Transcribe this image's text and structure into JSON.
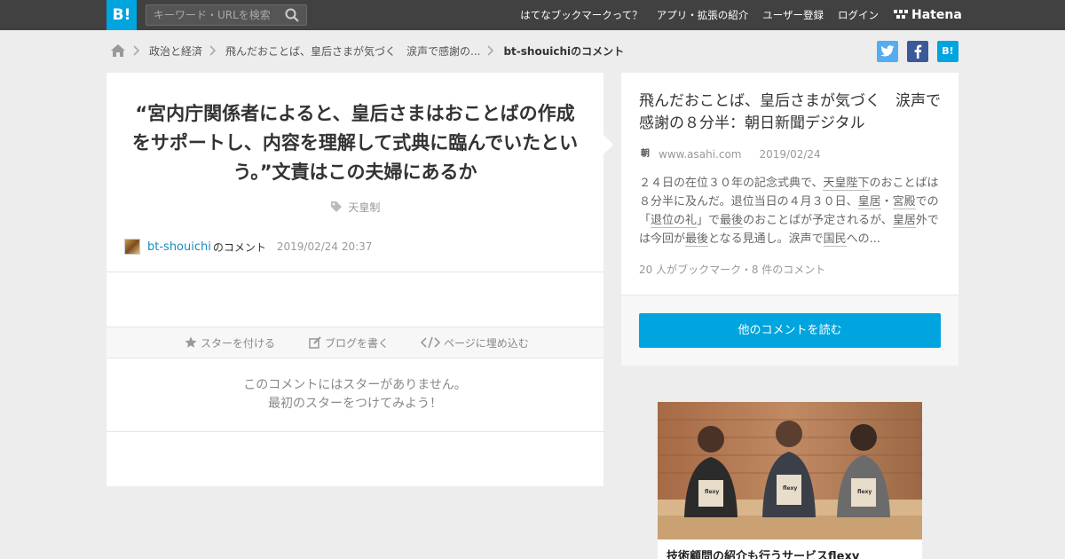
{
  "header": {
    "logo_text": "B!",
    "search_placeholder": "キーワード・URLを検索",
    "nav": [
      "はてなブックマークって？",
      "アプリ・拡張の紹介",
      "ユーザー登録",
      "ログイン"
    ],
    "brand": "Hatena"
  },
  "breadcrumb": {
    "items": [
      "政治と経済",
      "飛んだおことば、皇后さまが気づく　涙声で感謝の...",
      "bt-shouichiのコメント"
    ]
  },
  "social": {
    "twitter": "t",
    "facebook": "f",
    "hatena": "B!"
  },
  "comment": {
    "quote": "“宮内庁関係者によると、皇后さまはおことばの作成をサポートし、内容を理解して式典に臨んでいたという。”文責はこの夫婦にあるか",
    "tag": "天皇制",
    "user": "bt-shouichi",
    "user_suffix": "のコメント",
    "date": "2019/02/24 20:37",
    "actions": {
      "star": "スターを付ける",
      "blog": "ブログを書く",
      "embed": "ページに埋め込む"
    },
    "no_star_line1": "このコメントにはスターがありません。",
    "no_star_line2": "最初のスターをつけてみよう！"
  },
  "entry": {
    "title": "飛んだおことば、皇后さまが気づく　涙声で感謝の８分半：朝日新聞デジタル",
    "favicon": "朝",
    "domain": "www.asahi.com",
    "date": "2019/02/24",
    "excerpt_parts": [
      "２４日の在位３０年の記念式典で、",
      "天皇陛下",
      "のおことばは８分半に及んだ。退位当日の４月３０日、",
      "皇居",
      "・",
      "宮殿",
      "での「",
      "退位の礼",
      "」で",
      "最後",
      "のおことばが予定されるが、",
      "皇居",
      "外では今回が",
      "最後",
      "となる見通し。涙声で",
      "国民",
      "への..."
    ],
    "counts": "20 人がブックマーク・8 件のコメント",
    "read_more": "他のコメントを読む"
  },
  "ad": {
    "caption": "技術顧問の紹介も行うサービスflexy",
    "bag_label": "flexy"
  },
  "colors": {
    "accent": "#00a4de",
    "topbar": "#414141",
    "background": "#ededed"
  }
}
